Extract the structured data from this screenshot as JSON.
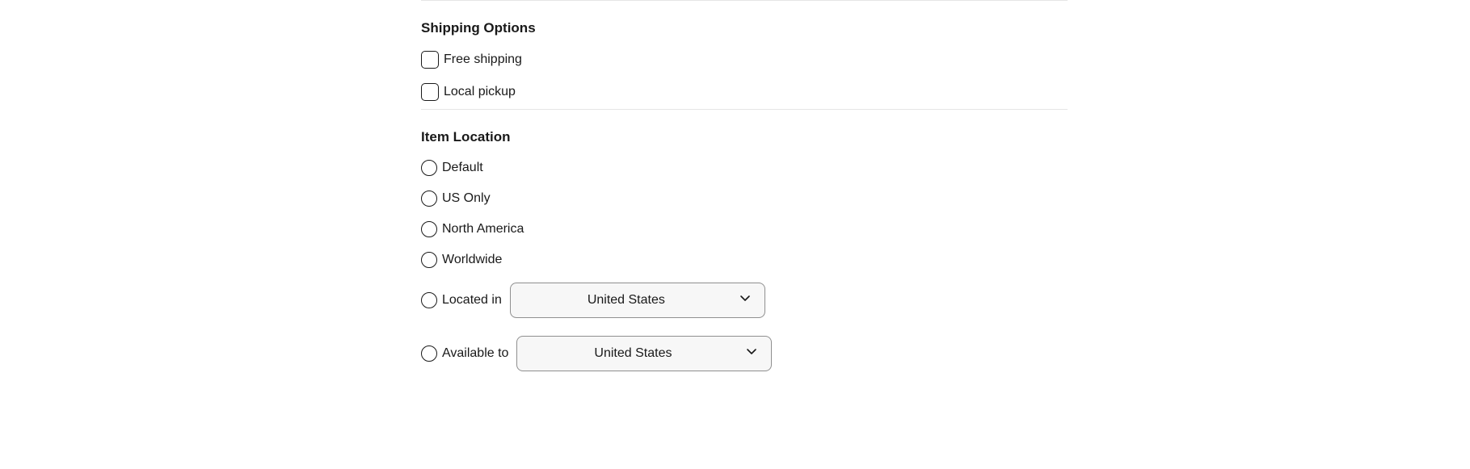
{
  "shipping": {
    "title": "Shipping Options",
    "options": [
      {
        "label": "Free shipping"
      },
      {
        "label": "Local pickup"
      }
    ]
  },
  "location": {
    "title": "Item Location",
    "options": [
      {
        "label": "Default"
      },
      {
        "label": "US Only"
      },
      {
        "label": "North America"
      },
      {
        "label": "Worldwide"
      }
    ],
    "located_in": {
      "label": "Located in",
      "value": "United States"
    },
    "available_to": {
      "label": "Available to",
      "value": "United States"
    }
  }
}
